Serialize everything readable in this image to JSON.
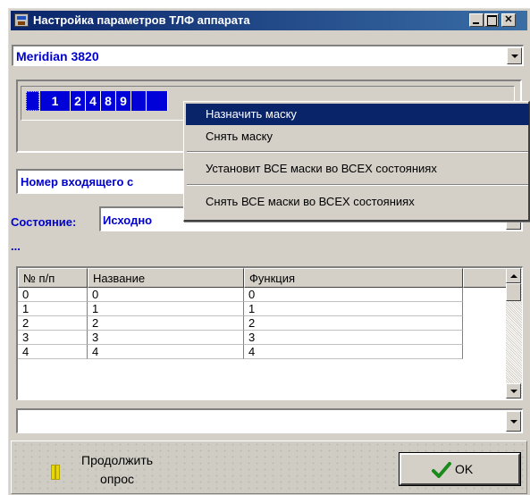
{
  "window": {
    "title": "Настройка параметров ТЛФ аппарата"
  },
  "model_combo": {
    "value": "Meridian 3820"
  },
  "mask": {
    "digits": [
      "",
      "1",
      "2",
      "4",
      "8",
      "9",
      "",
      ""
    ]
  },
  "incoming_combo": {
    "value": "Номер входящего с"
  },
  "state": {
    "label": "Состояние:",
    "value": "Исходно",
    "extra": "..."
  },
  "table": {
    "columns": [
      "№ п/п",
      "Название",
      "Функция",
      ""
    ],
    "rows": [
      [
        "0",
        "0",
        "0"
      ],
      [
        "1",
        "1",
        "1"
      ],
      [
        "2",
        "2",
        "2"
      ],
      [
        "3",
        "3",
        "3"
      ],
      [
        "4",
        "4",
        "4"
      ]
    ]
  },
  "bottom_combo": {
    "value": ""
  },
  "buttons": {
    "continue_line1": "Продолжить",
    "continue_line2": "опрос",
    "ok": "OK"
  },
  "context_menu": {
    "items": [
      "Назначить маску",
      "Снять маску",
      "Установит ВСЕ  маски во ВСЕХ состояниях",
      "Снять ВСЕ  маски во ВСЕХ состояниях"
    ]
  },
  "colors": {
    "title_bar": "#0a246a",
    "label_blue": "#0000cc",
    "mask_blue": "#0000d8",
    "menu_highlight": "#0a246a"
  }
}
